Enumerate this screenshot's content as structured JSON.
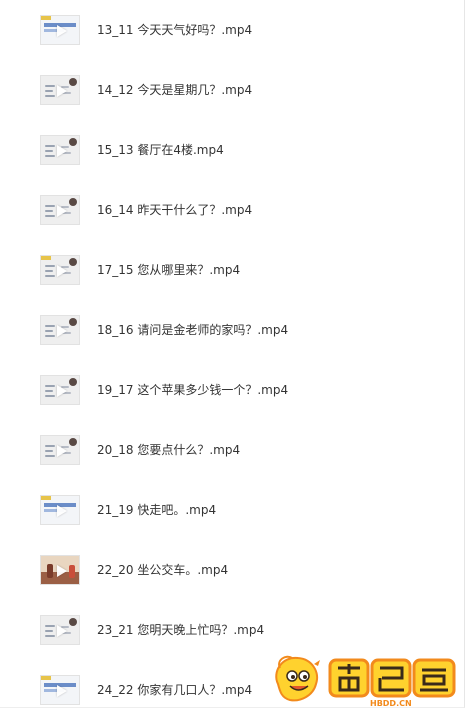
{
  "files": [
    {
      "name": "13_11 今天天气好吗？.mp4",
      "thumb": "title"
    },
    {
      "name": "14_12 今天是星期几？.mp4",
      "thumb": "slide"
    },
    {
      "name": "15_13 餐厅在4楼.mp4",
      "thumb": "slide"
    },
    {
      "name": "16_14 昨天干什么了？.mp4",
      "thumb": "slide"
    },
    {
      "name": "17_15 您从哪里来？.mp4",
      "thumb": "slide"
    },
    {
      "name": "18_16 请问是金老师的家吗？.mp4",
      "thumb": "slide"
    },
    {
      "name": "19_17 这个苹果多少钱一个？.mp4",
      "thumb": "slide"
    },
    {
      "name": "20_18 您要点什么？.mp4",
      "thumb": "slide"
    },
    {
      "name": "21_19 快走吧。.mp4",
      "thumb": "title"
    },
    {
      "name": "22_20 坐公交车。.mp4",
      "thumb": "scene"
    },
    {
      "name": "23_21 您明天晚上忙吗？.mp4",
      "thumb": "slide"
    },
    {
      "name": "24_22 你家有几口人？.mp4",
      "thumb": "title"
    }
  ],
  "watermark": {
    "brand_text": "荷包蛋",
    "domain_text": "HBDD.CN",
    "icon": "egg-mascot-icon",
    "colors": {
      "orange": "#f28a1c",
      "yellow": "#ffd22e",
      "dark": "#3a2a1a"
    }
  }
}
